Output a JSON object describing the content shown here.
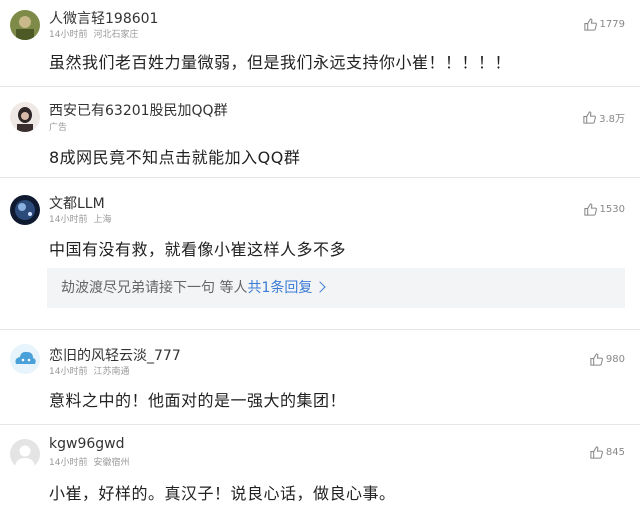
{
  "comments": [
    {
      "user": "人微言轻198601",
      "time": "14小时前",
      "location": "河北石家庄",
      "likes": "1779",
      "text": "虽然我们老百姓力量微弱，但是我们永远支持你小崔！！！！！",
      "avatar_color": "#6b7a3a"
    },
    {
      "user": "西安已有63201股民加QQ群",
      "time": "广告",
      "location": "",
      "likes": "3.8万",
      "text": "8成网民竟不知点击就能加入QQ群",
      "avatar_color": "#3a3030"
    },
    {
      "user": "文都LLM",
      "time": "14小时前",
      "location": "上海",
      "likes": "1530",
      "text": "中国有没有救，就看像小崔这样人多不多",
      "avatar_color": "#1b2a4a"
    },
    {
      "user": "恋旧的风轻云淡_777",
      "time": "14小时前",
      "location": "江苏南通",
      "likes": "980",
      "text": "意料之中的！他面对的是一强大的集团！",
      "avatar_color": "#4aa0d8"
    },
    {
      "user": "kgw96gwd",
      "time": "14小时前",
      "location": "安徽宿州",
      "likes": "845",
      "text": "小崔，好样的。真汉子！说良心话，做良心事。",
      "avatar_color": "#e2e2e2"
    }
  ],
  "reply": {
    "prefix": "劫波渡尽兄弟请接下一句  等人",
    "link": "共1条回复"
  },
  "colors": {
    "link": "#3b7cd6",
    "meta": "#999999",
    "divider": "#e6e6e6"
  },
  "icons": {
    "like": "thumbs-up-icon",
    "chevron": "chevron-right-icon"
  }
}
